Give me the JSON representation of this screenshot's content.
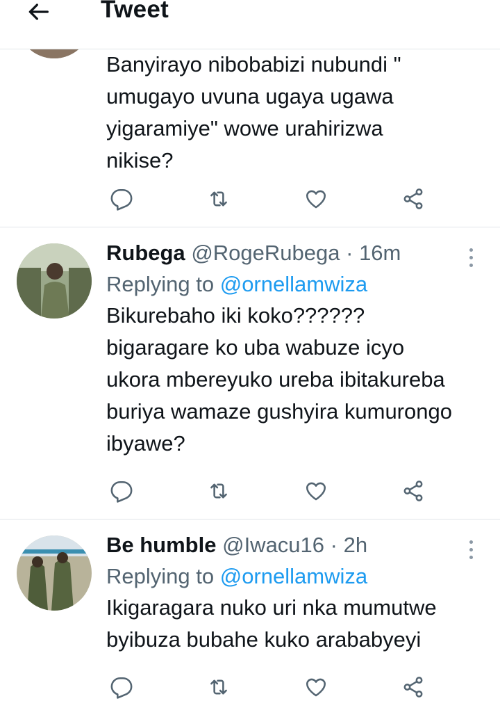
{
  "header": {
    "title": "Tweet"
  },
  "first_tweet": {
    "text_lines": [
      "Banyirayo nibobabizi nubundi \"",
      "umugayo uvuna ugaya ugawa",
      "yigaramiye\" wowe urahirizwa",
      "nikise?"
    ]
  },
  "replies": [
    {
      "name": "Rubega",
      "handle": "@RogeRubega",
      "separator": "·",
      "time": "16m",
      "replying_prefix": "Replying to",
      "replying_to": "@ornellamwiza",
      "text_lines": [
        "Bikurebaho iki koko??????",
        "bigaragare ko uba wabuze icyo",
        "ukora mbereyuko ureba ibitakureba",
        "buriya wamaze gushyira kumurongo",
        "ibyawe?"
      ]
    },
    {
      "name": "Be humble",
      "handle": "@Iwacu16",
      "separator": "·",
      "time": "2h",
      "replying_prefix": "Replying to",
      "replying_to": "@ornellamwiza",
      "text_lines": [
        "Ikigaragara nuko uri nka mumutwe",
        "byibuza bubahe kuko arababyeyi"
      ]
    }
  ],
  "icons": {
    "back": "arrow-left-icon",
    "reply": "reply-icon",
    "retweet": "retweet-icon",
    "like": "heart-icon",
    "share": "share-icon",
    "more": "more-icon"
  },
  "colors": {
    "accent": "#1d9bf0",
    "secondary": "#536471",
    "divider": "#e1e5e8"
  }
}
